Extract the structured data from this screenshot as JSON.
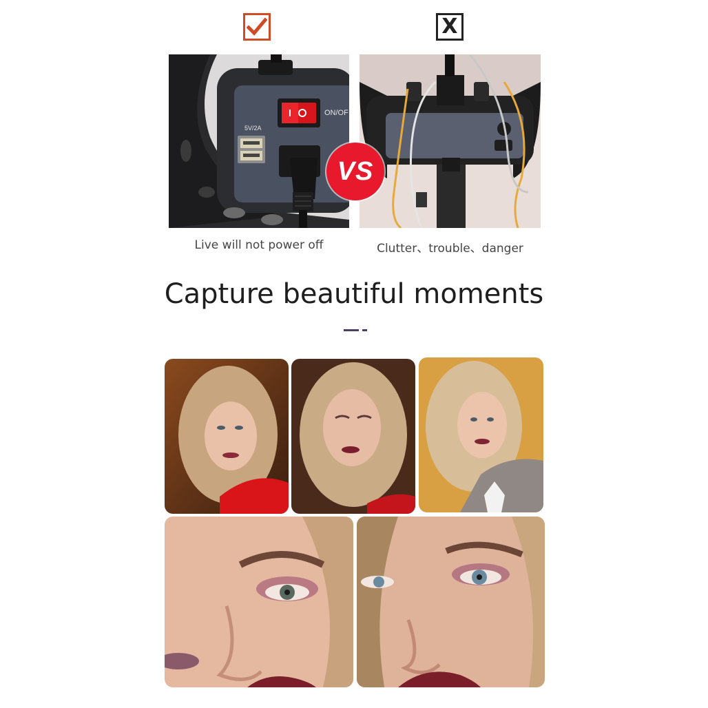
{
  "comparison": {
    "good_mark": "check-mark",
    "bad_mark_text": "X",
    "vs_text": "VS",
    "left_panel_labels": {
      "usb": "5V/2A",
      "switch": "ON/OF"
    },
    "left_caption": "Live will not power off",
    "right_caption": "Clutter、trouble、danger"
  },
  "headline": "Capture beautiful moments",
  "colors": {
    "check_red": "#d04a26",
    "vs_red": "#e8192c",
    "accent_purple": "#4a3f6a",
    "text_dark": "#1e1e1e"
  }
}
